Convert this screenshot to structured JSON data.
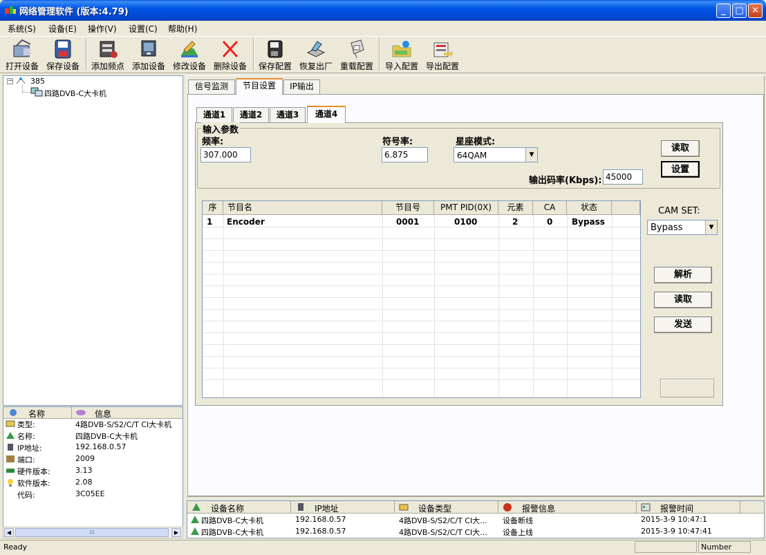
{
  "window": {
    "title": "网络管理软件 (版本:4.79)",
    "min": "_",
    "max": "□",
    "close": "✕"
  },
  "menu": [
    "系统(S)",
    "设备(E)",
    "操作(V)",
    "设置(C)",
    "帮助(H)"
  ],
  "toolbar": [
    {
      "label": "打开设备",
      "icon": "open-device-icon"
    },
    {
      "label": "保存设备",
      "icon": "save-device-icon"
    },
    {
      "label": "添加频点",
      "icon": "add-frequency-icon"
    },
    {
      "label": "添加设备",
      "icon": "add-device-icon"
    },
    {
      "label": "修改设备",
      "icon": "edit-device-icon"
    },
    {
      "label": "删除设备",
      "icon": "delete-device-icon"
    },
    {
      "label": "保存配置",
      "icon": "save-config-icon"
    },
    {
      "label": "恢复出厂",
      "icon": "factory-reset-icon"
    },
    {
      "label": "重载配置",
      "icon": "reload-config-icon"
    },
    {
      "label": "导入配置",
      "icon": "import-config-icon"
    },
    {
      "label": "导出配置",
      "icon": "export-config-icon"
    }
  ],
  "tree": {
    "root": "385",
    "child": "四路DVB-C大卡机"
  },
  "info": {
    "col_name": "名称",
    "col_info": "信息",
    "rows": [
      {
        "k": "类型:",
        "v": "4路DVB-S/S2/C/T CI大卡机"
      },
      {
        "k": "名称:",
        "v": "四路DVB-C大卡机"
      },
      {
        "k": "IP地址:",
        "v": "192.168.0.57"
      },
      {
        "k": "端口:",
        "v": "2009"
      },
      {
        "k": "硬件版本:",
        "v": "3.13"
      },
      {
        "k": "软件版本:",
        "v": "2.08"
      },
      {
        "k": "代码:",
        "v": "3C05EE"
      }
    ],
    "scroll_grip": "III"
  },
  "tabs": [
    "信号监测",
    "节目设置",
    "IP输出"
  ],
  "channel_tabs": [
    "通道1",
    "通道2",
    "通道3",
    "通道4"
  ],
  "input": {
    "legend": "输入参数",
    "freq_label": "频率:",
    "freq_value": "307.000",
    "symbol_label": "符号率:",
    "symbol_value": "6.875",
    "constellation_label": "星座模式:",
    "constellation_value": "64QAM",
    "bitrate_label": "输出码率(Kbps):",
    "bitrate_value": "45000",
    "read_btn": "读取",
    "set_btn": "设置"
  },
  "program_table": {
    "headers": [
      "序",
      "节目名",
      "节目号",
      "PMT PID(0X)",
      "元素",
      "CA",
      "状态"
    ],
    "rows": [
      [
        "1",
        "Encoder",
        "0001",
        "0100",
        "2",
        "0",
        "Bypass"
      ]
    ]
  },
  "cam": {
    "label": "CAM SET:",
    "value": "Bypass",
    "parse_btn": "解析",
    "read_btn": "读取",
    "send_btn": "发送"
  },
  "log": {
    "headers": [
      "设备名称",
      "IP地址",
      "设备类型",
      "报警信息",
      "报警时间"
    ],
    "rows": [
      [
        "四路DVB-C大卡机",
        "192.168.0.57",
        "4路DVB-S/S2/C/T CI大...",
        "设备断线",
        "2015-3-9 10:47:1"
      ],
      [
        "四路DVB-C大卡机",
        "192.168.0.57",
        "4路DVB-S/S2/C/T CI大...",
        "设备上线",
        "2015-3-9 10:47:41"
      ]
    ]
  },
  "status": {
    "left": "Ready",
    "num": "Number"
  }
}
